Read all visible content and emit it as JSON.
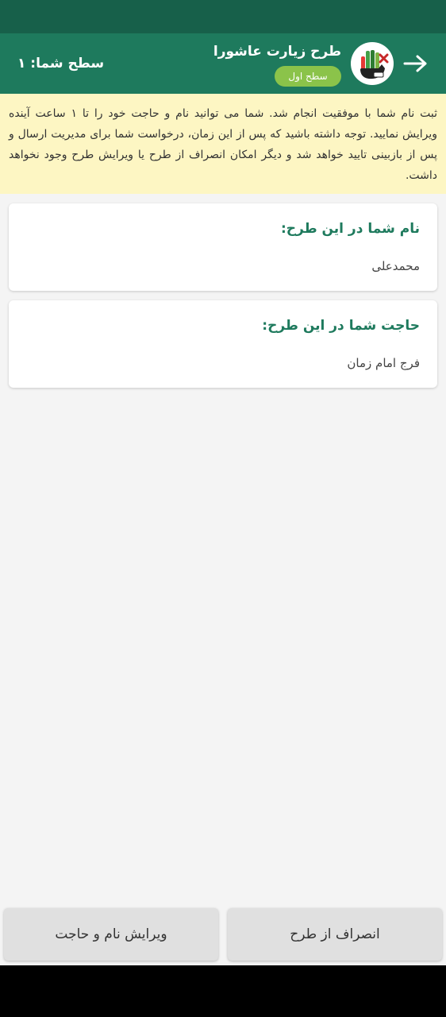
{
  "app_bar": {
    "title": "طرح زیارت عاشورا",
    "level_badge": "سطح اول",
    "user_level": "سطح شما: ۱",
    "back_icon": "arrow-right-icon",
    "logo_icon": "hand-logo-icon"
  },
  "notice": {
    "text": "ثبت نام شما با موفقیت انجام شد. شما می توانید نام و حاجت خود را تا ۱ ساعت آینده ویرایش نمایید. توجه داشته باشید که پس از این زمان، درخواست شما برای مدیریت ارسال و پس از بازبینی تایید خواهد شد و دیگر امکان انصراف از طرح یا ویرایش طرح وجود نخواهد داشت."
  },
  "cards": {
    "name": {
      "label": "نام شما در این طرح:",
      "value": "محمدعلی"
    },
    "need": {
      "label": "حاجت شما در این طرح:",
      "value": "فرج امام زمان"
    }
  },
  "buttons": {
    "withdraw": "انصراف از طرح",
    "edit": "ویرایش نام و حاجت"
  },
  "colors": {
    "status_bar": "#17604a",
    "app_bar": "#1e7a5d",
    "badge": "#8bc34a",
    "notice_bg": "#fdf6c3",
    "label_text": "#1e7a5d"
  }
}
